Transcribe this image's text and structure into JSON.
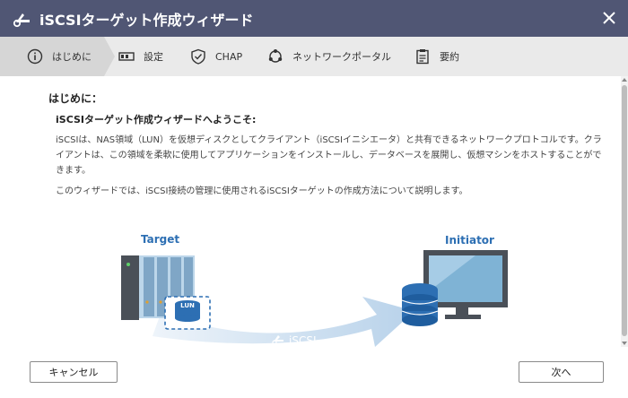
{
  "window": {
    "title": "iSCSIターゲット作成ウィザード"
  },
  "steps": [
    {
      "label": "はじめに",
      "icon": "info-icon",
      "active": true
    },
    {
      "label": "設定",
      "icon": "settings-icon"
    },
    {
      "label": "CHAP",
      "icon": "shield-icon"
    },
    {
      "label": "ネットワークポータル",
      "icon": "network-icon"
    },
    {
      "label": "要約",
      "icon": "clipboard-icon"
    }
  ],
  "content": {
    "heading": "はじめに：",
    "subheading": "iSCSIターゲット作成ウィザードへようこそ:",
    "para1": "iSCSIは、NAS領域（LUN）を仮想ディスクとしてクライアント（iSCSIイニシエータ）と共有できるネットワークプロトコルです。クライアントは、この領域を柔軟に使用してアプリケーションをインストールし、データベースを展開し、仮想マシンをホストすることができます。",
    "para2": "このウィザードでは、iSCSI接続の管理に使用されるiSCSIターゲットの作成方法について説明します。"
  },
  "illustration": {
    "target_label": "Target",
    "initiator_label": "Initiator",
    "lun_label": "LUN",
    "iscsi_label": "iSCSI"
  },
  "footer": {
    "cancel": "キャンセル",
    "next": "次へ"
  },
  "colors": {
    "titlebar": "#505674",
    "accent": "#2d6fb3",
    "steps_bg": "#eaeaea",
    "active_step": "#d6d6d6"
  }
}
